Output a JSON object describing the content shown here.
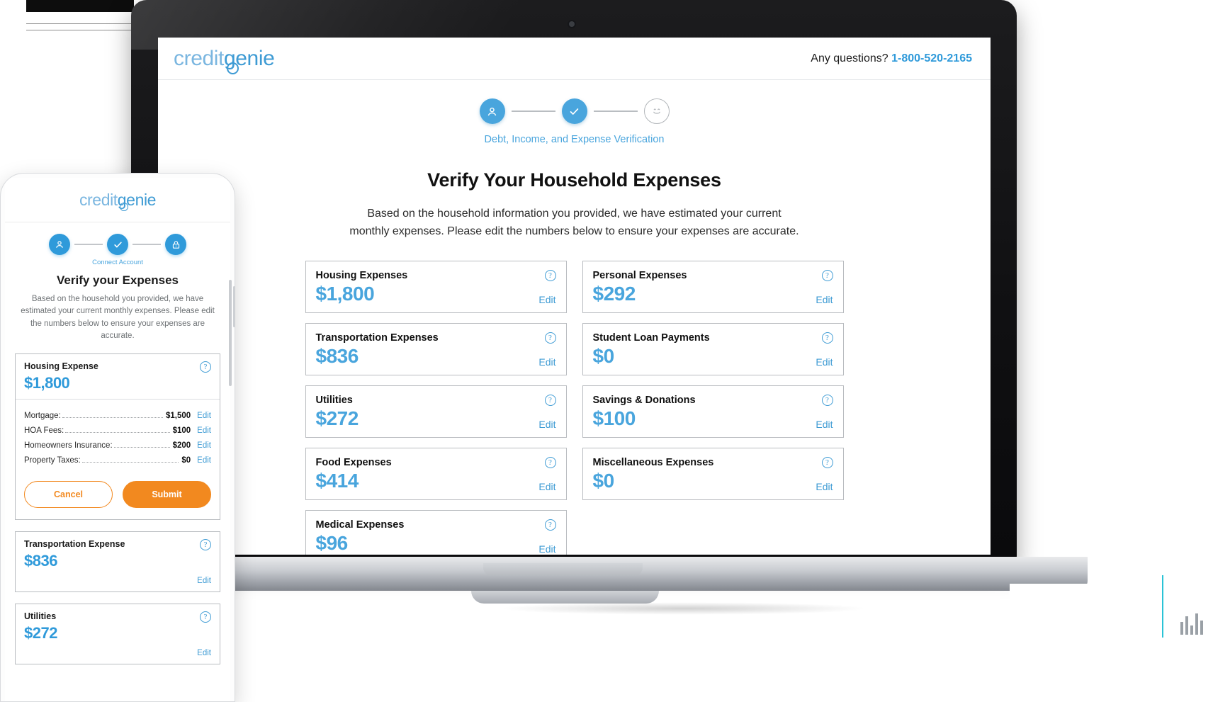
{
  "brand": {
    "logo_first": "credit",
    "logo_second": "genie",
    "accent_blue": "#49a5dd",
    "accent_orange": "#f2891f"
  },
  "desktop": {
    "header": {
      "help_label": "Any questions?",
      "phone": "1-800-520-2165"
    },
    "stepper": {
      "label": "Debt, Income, and Expense Verification",
      "steps": [
        {
          "icon": "person-icon",
          "state": "active"
        },
        {
          "icon": "check-icon",
          "state": "active"
        },
        {
          "icon": "smiley-icon",
          "state": "idle"
        }
      ]
    },
    "title": "Verify Your Household Expenses",
    "subtitle": "Based on the household information you provided, we have estimated your current monthly expenses. Please edit the numbers below to ensure your expenses are accurate.",
    "help_icon": "question-icon",
    "edit_label": "Edit",
    "cards": [
      {
        "title": "Housing Expenses",
        "amount": "$1,800"
      },
      {
        "title": "Personal Expenses",
        "amount": "$292"
      },
      {
        "title": "Transportation Expenses",
        "amount": "$836"
      },
      {
        "title": "Student Loan Payments",
        "amount": "$0"
      },
      {
        "title": "Utilities",
        "amount": "$272"
      },
      {
        "title": "Savings & Donations",
        "amount": "$100"
      },
      {
        "title": "Food Expenses",
        "amount": "$414"
      },
      {
        "title": "Miscellaneous Expenses",
        "amount": "$0"
      },
      {
        "title": "Medical Expenses",
        "amount": "$96"
      }
    ]
  },
  "mobile": {
    "stepper": {
      "label": "Connect Account",
      "steps": [
        {
          "icon": "person-icon",
          "state": "active"
        },
        {
          "icon": "check-icon",
          "state": "active"
        },
        {
          "icon": "lock-icon",
          "state": "active"
        }
      ]
    },
    "title": "Verify your Expenses",
    "subtitle": "Based on the household you provided, we have estimated your current monthly expenses. Please edit the numbers below to ensure your expenses are accurate.",
    "edit_label": "Edit",
    "housing": {
      "title": "Housing Expense",
      "amount": "$1,800",
      "lines": [
        {
          "label": "Mortgage:",
          "value": "$1,500"
        },
        {
          "label": "HOA Fees:",
          "value": "$100"
        },
        {
          "label": "Homeowners Insurance:",
          "value": "$200"
        },
        {
          "label": "Property Taxes:",
          "value": "$0"
        }
      ],
      "cancel_label": "Cancel",
      "submit_label": "Submit"
    },
    "cards": [
      {
        "title": "Transportation Expense",
        "amount": "$836"
      },
      {
        "title": "Utilities",
        "amount": "$272"
      }
    ]
  }
}
